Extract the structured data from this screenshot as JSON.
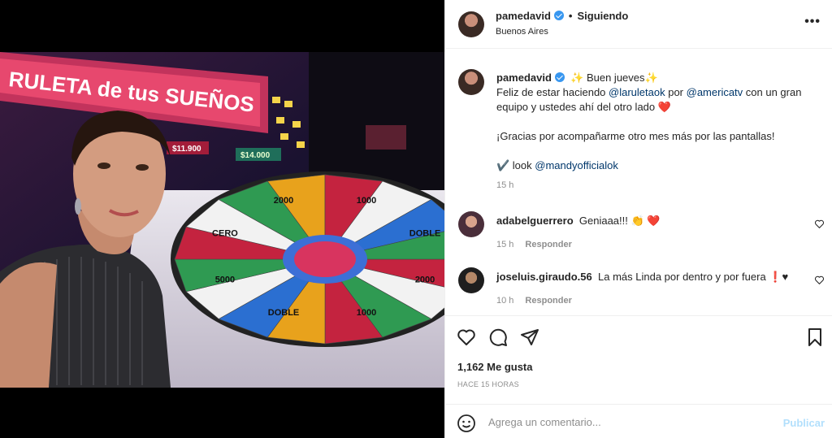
{
  "post": {
    "username": "pamedavid",
    "follow_status": "Siguiendo",
    "dot": "•",
    "location": "Buenos Aires",
    "more": "•••"
  },
  "caption": {
    "username": "pamedavid",
    "line1": "✨ Buen jueves✨",
    "line2a": "Feliz de estar haciendo ",
    "mention1": "@laruletaok",
    "line2b": " por ",
    "mention2": "@americatv",
    "line2c": " con un gran equipo y ustedes ahí del otro lado ",
    "heart": "❤️",
    "line3": "¡Gracias por acompañarme otro mes más por las pantallas!",
    "line4a": "✔️ look ",
    "mention3": "@mandyofficialok",
    "time": "15 h"
  },
  "comments": [
    {
      "username": "adabelguerrero",
      "text": "Geniaaa!!! 👏 ❤️",
      "time": "15 h",
      "reply": "Responder"
    },
    {
      "username": "joseluis.giraudo.56",
      "text": "La más Linda por dentro y por fuera ❗♥",
      "time": "10 h",
      "reply": "Responder"
    }
  ],
  "likes": "1,162 Me gusta",
  "ago": "HACE 15 HORAS",
  "add_comment": {
    "placeholder": "Agrega un comentario...",
    "publish": "Publicar"
  },
  "photo": {
    "sign_text": "RULETA de tus SUEÑOS",
    "price1": "$11.900",
    "price2": "$14.000",
    "wheel_values": [
      "2000",
      "1000",
      "DOBLE",
      "5000",
      "CERO",
      "2000",
      "1000",
      "DOBLE"
    ]
  },
  "colors": {
    "accent": "#0095f6",
    "publish_disabled": "#b2dffc",
    "mention": "#00376b",
    "heart": "#e0245e"
  }
}
